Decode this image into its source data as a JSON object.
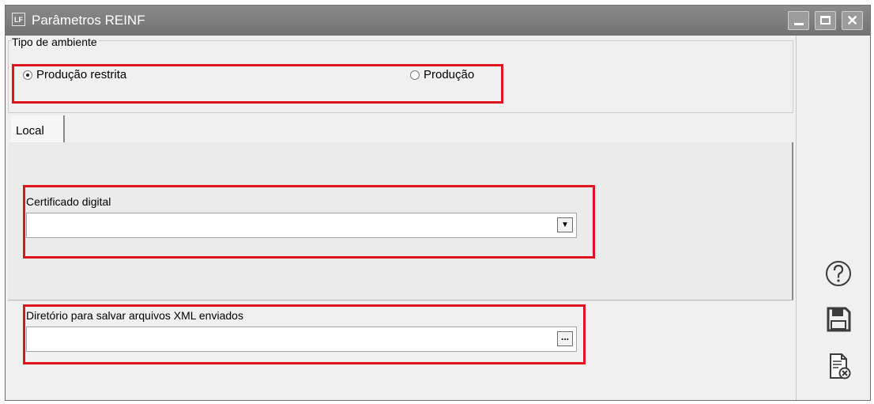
{
  "window": {
    "app_icon_text": "LF",
    "title": "Parâmetros REINF"
  },
  "tipo_ambiente": {
    "legend": "Tipo de ambiente",
    "options": [
      {
        "label": "Produção restrita",
        "selected": true
      },
      {
        "label": "Produção",
        "selected": false
      }
    ]
  },
  "tabs": [
    {
      "label": "Local",
      "active": true
    }
  ],
  "certificado": {
    "label": "Certificado digital",
    "value": ""
  },
  "diretorio": {
    "label": "Diretório para salvar arquivos XML enviados",
    "value": "",
    "browse_label": "..."
  },
  "highlight_color": "#e0141e",
  "side_actions": [
    {
      "name": "help-icon"
    },
    {
      "name": "save-icon"
    },
    {
      "name": "cancel-document-icon"
    }
  ]
}
